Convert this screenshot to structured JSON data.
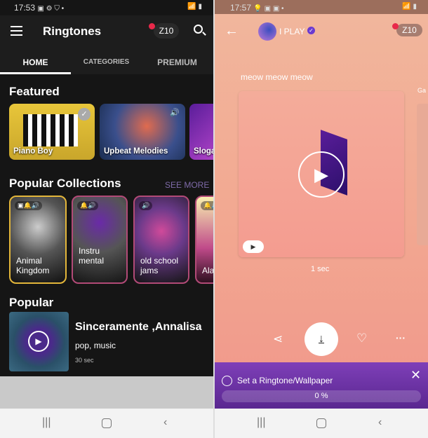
{
  "left": {
    "status": {
      "time": "17:53",
      "icons": "▣ ⚙ ⛉ •",
      "right": "📶 ▮"
    },
    "appbar": {
      "title": "Ringtones",
      "coins": "Z10"
    },
    "tabs": [
      {
        "label": "HOME",
        "active": true
      },
      {
        "label": "CATEGORIES"
      },
      {
        "label": "PREMIUM"
      }
    ],
    "featured": {
      "title": "Featured",
      "items": [
        {
          "label": "Piano Boy"
        },
        {
          "label": "Upbeat Melodies"
        },
        {
          "label": "Sloga"
        }
      ]
    },
    "collections": {
      "title": "Popular Collections",
      "see_more": "SEE MORE",
      "items": [
        {
          "label": "Animal Kingdom",
          "icons": "▣🔔🔊"
        },
        {
          "label": "Instru mental",
          "icons": "🔔🔊"
        },
        {
          "label": "old school jams",
          "icons": "🔊"
        },
        {
          "label": "Ala",
          "icons": "🔔🔊"
        }
      ]
    },
    "popular": {
      "title": "Popular",
      "items": [
        {
          "title": "Sinceramente ,Annalisa",
          "tags": "pop, music",
          "duration": "30 sec"
        }
      ]
    }
  },
  "right": {
    "status": {
      "time": "17:57",
      "icons": "💡 ▣ ▣ •"
    },
    "header": {
      "user": "I PLAY",
      "coins": "Z10"
    },
    "title": "meow meow meow",
    "next_label": "Ga",
    "duration": "1 sec",
    "panel": {
      "label": "Set a Ringtone/Wallpaper",
      "progress_text": "0 %",
      "progress": 0
    }
  },
  "colors": {
    "accent": "#7b3fb5",
    "coin_dot": "#e8294a",
    "collection_border": "#b24a77",
    "selected_border": "#e3b63a"
  }
}
